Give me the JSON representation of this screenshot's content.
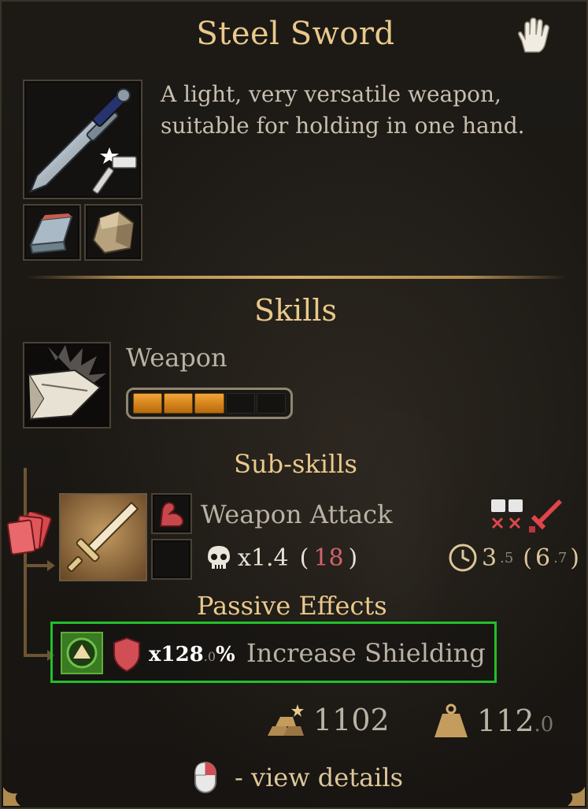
{
  "item": {
    "title": "Steel Sword",
    "description": "A light, very versatile weapon, suitable for holding in one hand.",
    "icon": "steel-sword-icon",
    "materials": [
      "steel-ingot-icon",
      "stone-icon"
    ]
  },
  "skills": {
    "heading": "Skills",
    "weapon": {
      "label": "Weapon",
      "level_segments_filled": 3,
      "level_segments_total": 5
    },
    "subskills_heading": "Sub-skills",
    "attack": {
      "name": "Weapon Attack",
      "multiplier": "x1.4",
      "paren_open": "(",
      "damage": "18",
      "paren_close": ")",
      "time_main": "3",
      "time_decimal": ".5",
      "time_paren_open": "(",
      "time_total_main": "6",
      "time_total_decimal": ".7",
      "time_paren_close": ")"
    },
    "passive_heading": "Passive Effects",
    "passive": {
      "multiplier": "x128",
      "multiplier_decimal": ".0",
      "percent": "%",
      "name": "Increase Shielding"
    }
  },
  "footer": {
    "price": "1102",
    "weight_main": "112",
    "weight_decimal": ".0",
    "hint": "- view details"
  },
  "colors": {
    "title_gold": "#e9c98b",
    "bar_orange": "#d6861c",
    "highlight_green": "#22c02a",
    "damage_red": "#d2636a"
  }
}
